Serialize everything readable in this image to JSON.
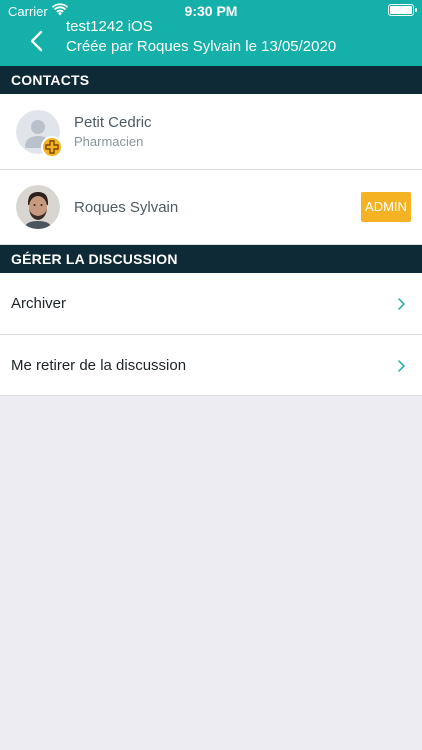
{
  "status_bar": {
    "carrier": "Carrier",
    "time": "9:30 PM"
  },
  "header": {
    "title": "test1242 iOS",
    "subtitle": "Créée par Roques Sylvain le 13/05/2020",
    "back_icon": "chevron-left-icon",
    "background_color": "#16b0aa"
  },
  "contacts_section": {
    "title": "CONTACTS",
    "items": [
      {
        "name": "Petit Cedric",
        "role": "Pharmacien",
        "avatar": "default-user-avatar",
        "badge_icon": "add-plus-icon"
      },
      {
        "name": "Roques Sylvain",
        "role": "",
        "avatar": "user-photo-avatar",
        "badge": "ADMIN"
      }
    ]
  },
  "manage_section": {
    "title": "GÉRER LA DISCUSSION",
    "items": [
      {
        "label": "Archiver"
      },
      {
        "label": "Me retirer de la discussion"
      }
    ]
  },
  "colors": {
    "section_header_bg": "#0f2a37",
    "admin_badge": "#f5b324",
    "chevron": "#16b0aa"
  }
}
